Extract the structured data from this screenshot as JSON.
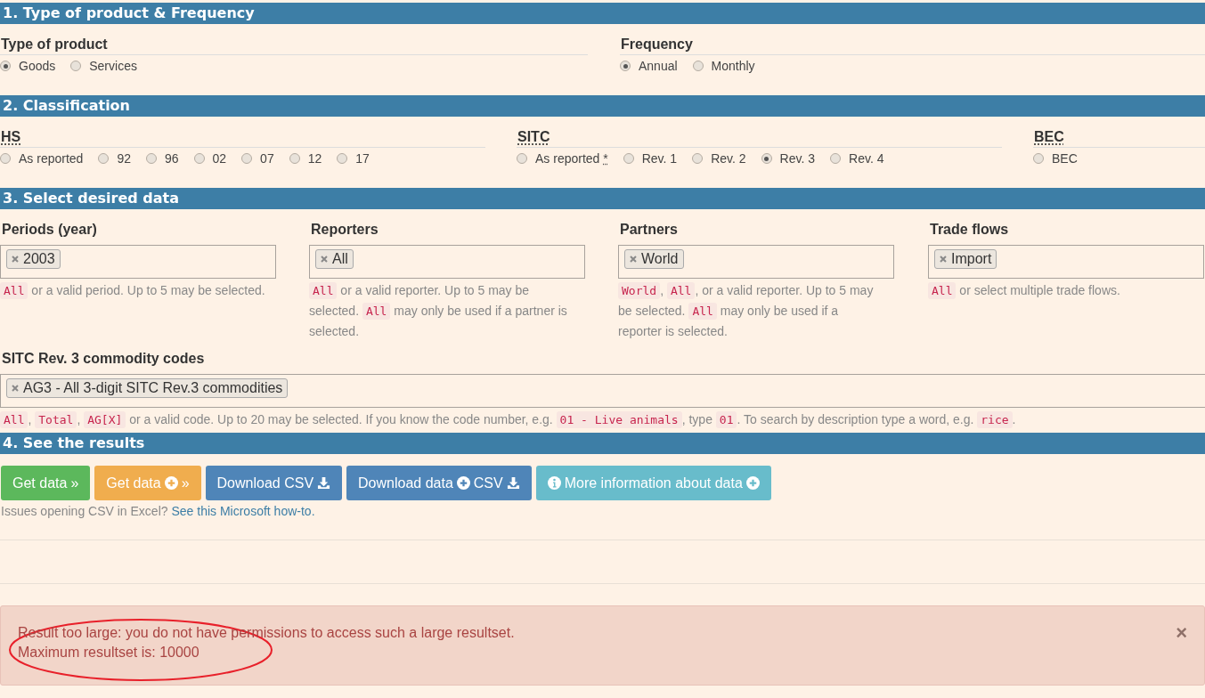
{
  "sections": [
    {
      "title": "1. Type of product & Frequency",
      "kind": "radios",
      "groups": [
        {
          "label": "Type of product",
          "abbr": false,
          "options": [
            {
              "label": "Goods",
              "selected": true
            },
            {
              "label": "Services",
              "selected": false
            }
          ]
        },
        {
          "label": "Frequency",
          "abbr": false,
          "options": [
            {
              "label": "Annual",
              "selected": true
            },
            {
              "label": "Monthly",
              "selected": false
            }
          ]
        }
      ]
    },
    {
      "title": "2. Classification",
      "kind": "radios",
      "groups": [
        {
          "label": "HS",
          "abbr": true,
          "options": [
            {
              "label": "As reported",
              "selected": false
            },
            {
              "label": "92",
              "selected": false
            },
            {
              "label": "96",
              "selected": false
            },
            {
              "label": "02",
              "selected": false
            },
            {
              "label": "07",
              "selected": false
            },
            {
              "label": "12",
              "selected": false
            },
            {
              "label": "17",
              "selected": false
            }
          ]
        },
        {
          "label": "SITC",
          "abbr": true,
          "options": [
            {
              "label": "As reported",
              "note": "*",
              "selected": false
            },
            {
              "label": "Rev. 1",
              "selected": false
            },
            {
              "label": "Rev. 2",
              "selected": false
            },
            {
              "label": "Rev. 3",
              "selected": true
            },
            {
              "label": "Rev. 4",
              "selected": false
            }
          ]
        },
        {
          "label": "BEC",
          "abbr": true,
          "options": [
            {
              "label": "BEC",
              "selected": false
            }
          ]
        }
      ]
    },
    {
      "title": "3. Select desired data",
      "kind": "fields",
      "fields": [
        {
          "label": "Periods (year)",
          "wide": false,
          "tags": [
            "2003"
          ],
          "help": [
            {
              "kind": "code",
              "text": "All"
            },
            {
              "kind": "text",
              "text": " or a valid period. Up to 5 may be selected."
            }
          ]
        },
        {
          "label": "Reporters",
          "wide": false,
          "tags": [
            "All"
          ],
          "help": [
            {
              "kind": "code",
              "text": "All"
            },
            {
              "kind": "text",
              "text": " or a valid reporter. Up to 5 may be selected. "
            },
            {
              "kind": "code",
              "text": "All"
            },
            {
              "kind": "text",
              "text": " may only be used if a partner is selected."
            }
          ]
        },
        {
          "label": "Partners",
          "wide": false,
          "tags": [
            "World"
          ],
          "help": [
            {
              "kind": "code",
              "text": "World"
            },
            {
              "kind": "text",
              "text": ", "
            },
            {
              "kind": "code",
              "text": "All"
            },
            {
              "kind": "text",
              "text": ", or a valid reporter. Up to 5 may be selected. "
            },
            {
              "kind": "code",
              "text": "All"
            },
            {
              "kind": "text",
              "text": " may only be used if a reporter is selected."
            }
          ]
        },
        {
          "label": "Trade flows",
          "wide": false,
          "tags": [
            "Import"
          ],
          "help": [
            {
              "kind": "code",
              "text": "All"
            },
            {
              "kind": "text",
              "text": " or select multiple trade flows."
            }
          ]
        },
        {
          "label": "SITC Rev. 3 commodity codes",
          "wide": true,
          "tags": [
            "AG3 - All 3-digit SITC Rev.3 commodities"
          ],
          "help": [
            {
              "kind": "code",
              "text": "All"
            },
            {
              "kind": "text",
              "text": ", "
            },
            {
              "kind": "code",
              "text": "Total"
            },
            {
              "kind": "text",
              "text": ", "
            },
            {
              "kind": "code",
              "text": "AG[X]"
            },
            {
              "kind": "text",
              "text": " or a valid code. Up to 20 may be selected. If you know the code number, e.g. "
            },
            {
              "kind": "code",
              "text": "01 - Live animals"
            },
            {
              "kind": "text",
              "text": ", type "
            },
            {
              "kind": "code",
              "text": "01"
            },
            {
              "kind": "text",
              "text": ". To search by description type a word, e.g. "
            },
            {
              "kind": "code",
              "text": "rice"
            },
            {
              "kind": "text",
              "text": "."
            }
          ]
        }
      ]
    },
    {
      "title": "4. See the results",
      "kind": "results",
      "buttons": [
        {
          "parts": [
            {
              "kind": "text",
              "text": "Get data"
            },
            {
              "kind": "text",
              "text": "»"
            }
          ]
        },
        {
          "parts": [
            {
              "kind": "text",
              "text": "Get data"
            },
            {
              "kind": "plus"
            },
            {
              "kind": "text",
              "text": "»"
            }
          ]
        },
        {
          "parts": [
            {
              "kind": "text",
              "text": "Download CSV"
            },
            {
              "kind": "download"
            }
          ]
        },
        {
          "parts": [
            {
              "kind": "text",
              "text": "Download data"
            },
            {
              "kind": "plus"
            },
            {
              "kind": "text",
              "text": "CSV"
            },
            {
              "kind": "download"
            }
          ]
        },
        {
          "parts": [
            {
              "kind": "info"
            },
            {
              "kind": "text",
              "text": "More information about data"
            },
            {
              "kind": "plus"
            }
          ]
        }
      ],
      "note": {
        "text": "Issues opening CSV in Excel? ",
        "link": "See this Microsoft how-to."
      }
    }
  ],
  "alert": {
    "lines": [
      "Result too large: you do not have permissions to access such a large resultset.",
      "Maximum resultset is: 10000"
    ],
    "close": "×",
    "annotated": true
  }
}
